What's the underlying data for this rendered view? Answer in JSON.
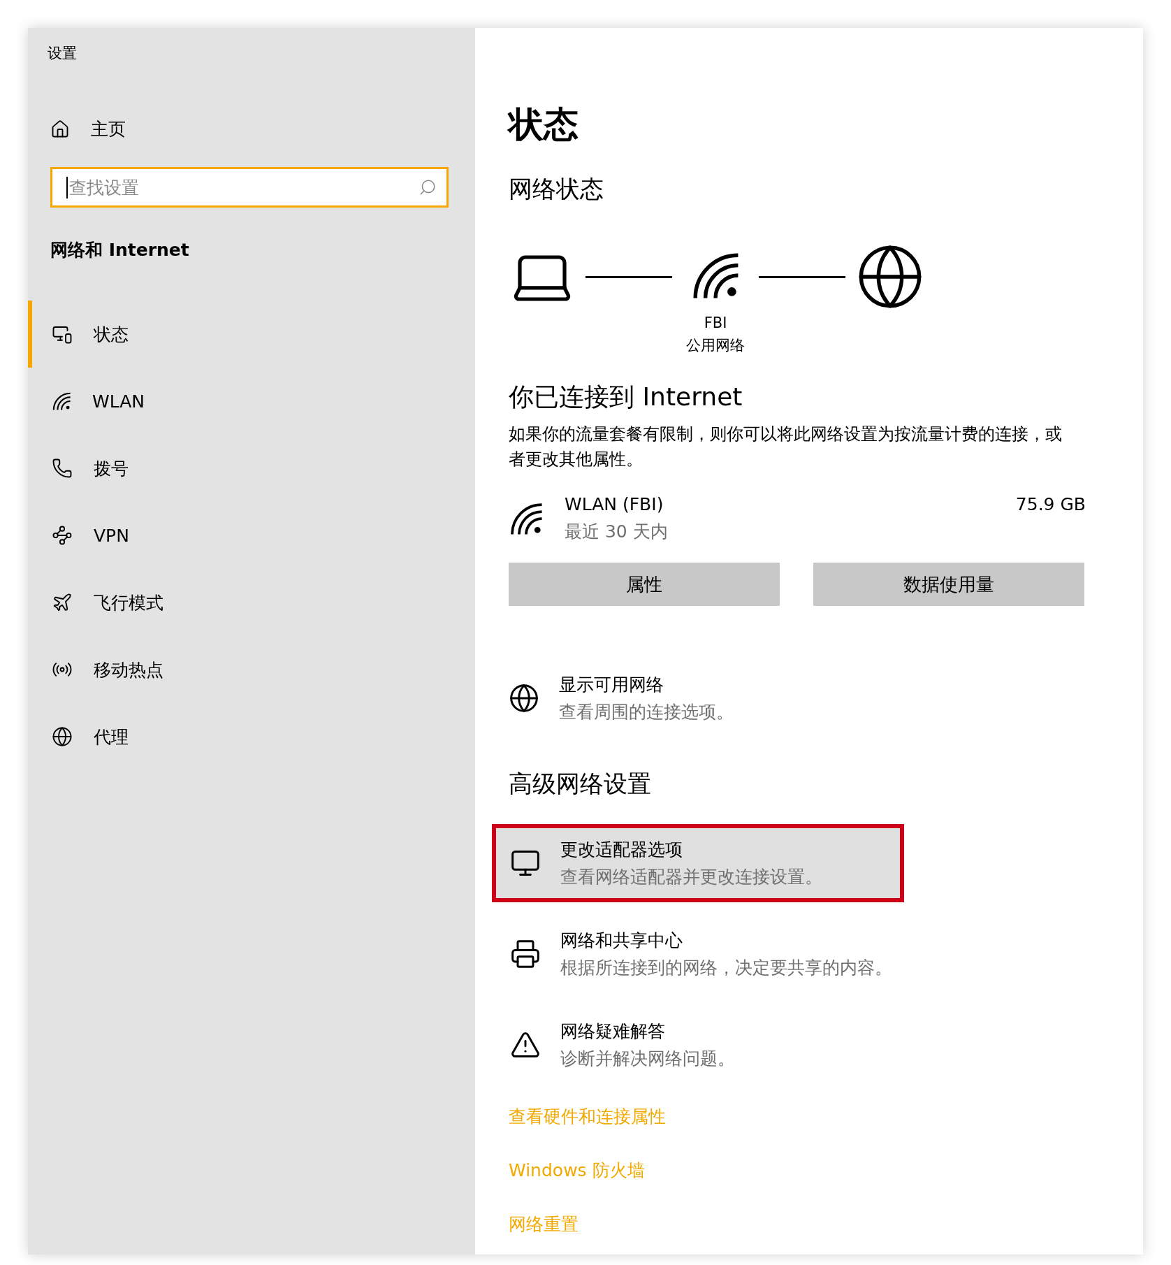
{
  "window": {
    "title": "设置"
  },
  "sidebar": {
    "home": "主页",
    "search": {
      "placeholder": "查找设置"
    },
    "section": "网络和 Internet",
    "items": [
      {
        "label": "状态",
        "kind": "status",
        "selected": true
      },
      {
        "label": "WLAN",
        "kind": "wlan",
        "selected": false
      },
      {
        "label": "拨号",
        "kind": "dialup",
        "selected": false
      },
      {
        "label": "VPN",
        "kind": "vpn",
        "selected": false
      },
      {
        "label": "飞行模式",
        "kind": "airplane",
        "selected": false
      },
      {
        "label": "移动热点",
        "kind": "hotspot",
        "selected": false
      },
      {
        "label": "代理",
        "kind": "proxy",
        "selected": false
      }
    ]
  },
  "main": {
    "title": "状态",
    "network_status": {
      "heading": "网络状态",
      "network_name": "FBI",
      "network_type": "公用网络"
    },
    "connected": {
      "heading": "你已连接到 Internet",
      "description": "如果你的流量套餐有限制，则你可以将此网络设置为按流量计费的连接，或者更改其他属性。",
      "adapter": {
        "name": "WLAN (FBI)",
        "period": "最近 30 天内",
        "usage": "75.9 GB"
      },
      "buttons": [
        "属性",
        "数据使用量"
      ]
    },
    "show_networks": {
      "title": "显示可用网络",
      "subtitle": "查看周围的连接选项。"
    },
    "advanced": {
      "heading": "高级网络设置",
      "items": [
        {
          "kind": "adapter",
          "title": "更改适配器选项",
          "subtitle": "查看网络适配器并更改连接设置。",
          "highlighted": true
        },
        {
          "kind": "sharing",
          "title": "网络和共享中心",
          "subtitle": "根据所连接到的网络，决定要共享的内容。",
          "highlighted": false
        },
        {
          "kind": "troubleshoot",
          "title": "网络疑难解答",
          "subtitle": "诊断并解决网络问题。",
          "highlighted": false
        }
      ],
      "links": [
        "查看硬件和连接属性",
        "Windows 防火墙",
        "网络重置"
      ]
    }
  }
}
